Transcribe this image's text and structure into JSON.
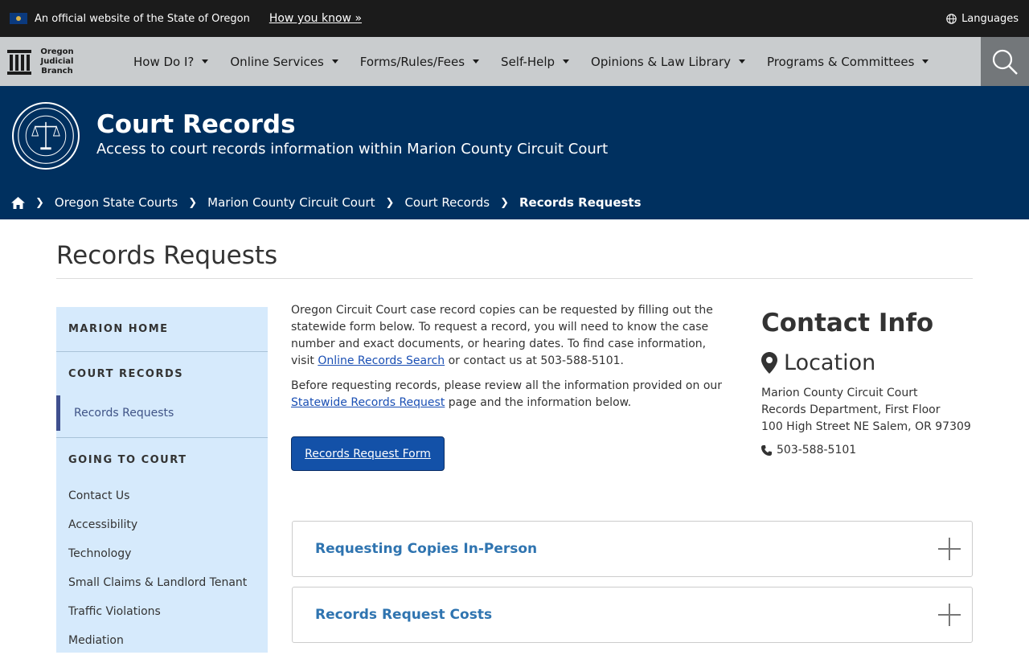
{
  "official": {
    "text": "An official website of the State of Oregon",
    "how_link": "How you know »",
    "languages": "Languages"
  },
  "nav": {
    "brand_line1": "Oregon",
    "brand_line2": "Judicial",
    "brand_line3": "Branch",
    "items": [
      {
        "label": "How Do I?"
      },
      {
        "label": "Online Services"
      },
      {
        "label": "Forms/Rules/Fees"
      },
      {
        "label": "Self-Help"
      },
      {
        "label": "Opinions & Law Library"
      },
      {
        "label": "Programs & Committees"
      }
    ]
  },
  "hero": {
    "title": "Court Records",
    "subtitle": "Access to court records information within Marion County Circuit Court"
  },
  "breadcrumb": {
    "items": [
      "Oregon State Courts",
      "Marion County Circuit Court",
      "Court Records"
    ],
    "current": "Records Requests"
  },
  "page": {
    "title": "Records Requests"
  },
  "sidebar": {
    "home": "MARION HOME",
    "section": "COURT RECORDS",
    "active": "Records Requests",
    "section2": "GOING TO COURT",
    "links": [
      "Contact Us",
      "Accessibility",
      "Technology",
      "Small Claims & Landlord Tenant",
      "Traffic Violations",
      "Mediation"
    ]
  },
  "content": {
    "p1_a": "Oregon Circuit Court case record copies can be requested by filling out the statewide form below. To request a record, you will need to know the case number and exact documents, or hearing dates. To find case information, visit ",
    "p1_link": "Online Records Search",
    "p1_b": " or contact us at 503-588-5101.",
    "p2_a": "Before requesting records, please review all the information provided on our ",
    "p2_link": "Statewide Records Request",
    "p2_b": " page and the information below.",
    "button": "Records Request Form"
  },
  "contact": {
    "title": "Contact Info",
    "location": "Location",
    "addr1": "Marion County Circuit Court",
    "addr2": "Records Department, First Floor",
    "addr3": "100 High Street NE Salem, OR 97309",
    "phone": "503-588-5101"
  },
  "accordions": [
    {
      "label": "Requesting Copies In-Person"
    },
    {
      "label": "Records Request Costs"
    }
  ],
  "colors": {
    "hero": "#00305f",
    "nav": "#c9ccce",
    "sidebar": "#d6eafc",
    "button": "#1351a8",
    "accordion_text": "#2f74b0"
  }
}
